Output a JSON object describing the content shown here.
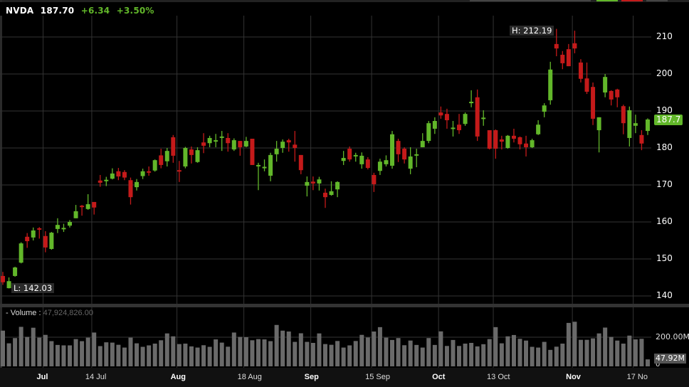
{
  "header": {
    "symbol": "NVDA",
    "price": "187.70",
    "change": "+6.34",
    "change_pct": "+3.50%"
  },
  "labels": {
    "high": "H: 212.19",
    "low": "L: 142.03",
    "current": "187.7"
  },
  "volume": {
    "label": "- Volume :",
    "value": "47,924,826.00",
    "axis_label": "200.00M",
    "zero_label": "0",
    "current": "47.92M"
  },
  "colors": {
    "up": "#62b72a",
    "down": "#c41a1a",
    "volume": "#6a6a6a",
    "grid": "#333333"
  },
  "chart_data": {
    "type": "candlestick",
    "title": "NVDA",
    "yticks": [
      140,
      150,
      160,
      170,
      180,
      190,
      200,
      210
    ],
    "ylim": [
      138,
      216
    ],
    "xticks": [
      {
        "label": "Jul",
        "i": 7,
        "bold": true
      },
      {
        "label": "14 Jul",
        "i": 15,
        "bold": false
      },
      {
        "label": "Aug",
        "i": 29,
        "bold": true
      },
      {
        "label": "18 Aug",
        "i": 40,
        "bold": false
      },
      {
        "label": "Sep",
        "i": 51,
        "bold": true
      },
      {
        "label": "15 Sep",
        "i": 61,
        "bold": false
      },
      {
        "label": "Oct",
        "i": 72,
        "bold": true
      },
      {
        "label": "13 Oct",
        "i": 81,
        "bold": false
      },
      {
        "label": "Nov",
        "i": 94,
        "bold": true
      },
      {
        "label": "17 No",
        "i": 104,
        "bold": false
      }
    ],
    "ohlc": [
      [
        145.4,
        146.5,
        143,
        143.7
      ],
      [
        142.1,
        145,
        142.03,
        144.0
      ],
      [
        145.4,
        147.9,
        145.2,
        147.7
      ],
      [
        149,
        154.5,
        148.8,
        154.2
      ],
      [
        156,
        157,
        153,
        154.8
      ],
      [
        155.8,
        158.5,
        155,
        157.7
      ],
      [
        158.3,
        158.6,
        155.5,
        157.9
      ],
      [
        156.2,
        157.5,
        151.8,
        153.1
      ],
      [
        152.7,
        157.3,
        152.5,
        157.1
      ],
      [
        158.1,
        161,
        157,
        159.2
      ],
      [
        158.2,
        159.5,
        157.3,
        158.4
      ],
      [
        159,
        160.5,
        158.5,
        160
      ],
      [
        161,
        164.6,
        161,
        162.9
      ],
      [
        164.4,
        164.6,
        161.7,
        164
      ],
      [
        163.5,
        167.5,
        163.3,
        164.8
      ],
      [
        165.4,
        165.4,
        162,
        163.9
      ],
      [
        171.2,
        172.7,
        169.5,
        170.6
      ],
      [
        171.2,
        172.2,
        169.7,
        171.4
      ],
      [
        171.7,
        174.5,
        171.5,
        173.1
      ],
      [
        173.7,
        174.6,
        171.3,
        172.3
      ],
      [
        173.5,
        174,
        171.3,
        172.0
      ],
      [
        171.3,
        172,
        164.7,
        166.7
      ],
      [
        169.4,
        171.6,
        168.5,
        170.8
      ],
      [
        172.4,
        174.4,
        171.6,
        173.7
      ],
      [
        173.7,
        175,
        172.5,
        173.5
      ],
      [
        173.9,
        176.9,
        173.6,
        176.7
      ],
      [
        178,
        179.8,
        174.5,
        175.4
      ],
      [
        176.4,
        180,
        175,
        179.2
      ],
      [
        182.9,
        183.5,
        176,
        177.9
      ],
      [
        174,
        176.5,
        170.8,
        173.7
      ],
      [
        175,
        180.3,
        174.5,
        180
      ],
      [
        179.6,
        180.4,
        175.8,
        178.1
      ],
      [
        176.2,
        180.2,
        176,
        179.4
      ],
      [
        181.5,
        184,
        178.6,
        180.6
      ],
      [
        181.3,
        183.3,
        180.2,
        182.7
      ],
      [
        181.9,
        183.8,
        180.2,
        182.1
      ],
      [
        182.9,
        184.6,
        179.2,
        183.1
      ],
      [
        182.7,
        184,
        179,
        181.3
      ],
      [
        179.6,
        182.6,
        179.2,
        182.1
      ],
      [
        181.9,
        181.9,
        177.9,
        180.2
      ],
      [
        180.4,
        183,
        180.2,
        181.9
      ],
      [
        182.5,
        182.5,
        175.4,
        175.4
      ],
      [
        175.2,
        176,
        168.6,
        175.4
      ],
      [
        174.6,
        176.9,
        173.7,
        174.9
      ],
      [
        172.5,
        178.7,
        171,
        178.1
      ],
      [
        178.3,
        181.9,
        176.3,
        179.8
      ],
      [
        180,
        182.3,
        178.7,
        181.7
      ],
      [
        182.1,
        182.5,
        179,
        181.5
      ],
      [
        180.9,
        184.6,
        176.3,
        180
      ],
      [
        178.1,
        178.1,
        172.9,
        174
      ],
      [
        169.8,
        172.3,
        166.9,
        170.8
      ],
      [
        170.9,
        172.3,
        168.6,
        170.4
      ],
      [
        170.4,
        172.2,
        168.5,
        171.5
      ],
      [
        167.9,
        169,
        163.8,
        166.7
      ],
      [
        167.3,
        171,
        167.1,
        168.3
      ],
      [
        168.8,
        171,
        166.7,
        170.8
      ],
      [
        176.5,
        179.2,
        175.4,
        177.3
      ],
      [
        179.8,
        180.4,
        176.3,
        176.9
      ],
      [
        177.9,
        178.7,
        176.3,
        178.1
      ],
      [
        175.6,
        178.8,
        174.4,
        177.9
      ],
      [
        176.9,
        177.5,
        174.2,
        174.6
      ],
      [
        172.7,
        173.3,
        168.1,
        170.2
      ],
      [
        173.8,
        177.1,
        172.7,
        176.3
      ],
      [
        175.6,
        178,
        175,
        176.7
      ],
      [
        175.2,
        184.6,
        174.4,
        183.7
      ],
      [
        181.9,
        182.5,
        176.2,
        178.3
      ],
      [
        179.8,
        180.2,
        175.8,
        176.9
      ],
      [
        174.4,
        180.2,
        172.9,
        177.7
      ],
      [
        178.1,
        179.8,
        174.8,
        178.3
      ],
      [
        180.2,
        184,
        180.2,
        181.9
      ],
      [
        181.9,
        187.3,
        181.3,
        186.7
      ],
      [
        185.2,
        188.3,
        183.8,
        187.3
      ],
      [
        189.6,
        191.2,
        187.9,
        188.8
      ],
      [
        189.2,
        190.6,
        185.2,
        187.5
      ],
      [
        185.3,
        187.3,
        183.1,
        185.5
      ],
      [
        186.3,
        189.2,
        183.8,
        184.8
      ],
      [
        186.5,
        189.6,
        186,
        189.2
      ],
      [
        192.1,
        195.6,
        191,
        192.5
      ],
      [
        193.7,
        195.8,
        181.9,
        183.1
      ],
      [
        188,
        190.2,
        186,
        188.2
      ],
      [
        184.8,
        184.8,
        179.6,
        179.8
      ],
      [
        184.8,
        185,
        177.1,
        179.8
      ],
      [
        182.3,
        183.3,
        179.6,
        181.7
      ],
      [
        180,
        183.5,
        179.8,
        183.3
      ],
      [
        183.3,
        185.2,
        181.5,
        182.5
      ],
      [
        182.9,
        183.1,
        179.6,
        181
      ],
      [
        181.2,
        183.3,
        177.7,
        180.2
      ],
      [
        180.2,
        182.5,
        180,
        182.1
      ],
      [
        183.7,
        187.5,
        183.5,
        186.3
      ],
      [
        189.8,
        192.1,
        188.3,
        191.5
      ],
      [
        192.9,
        203.3,
        191.7,
        201.2
      ],
      [
        208.1,
        212.19,
        204.8,
        206.9
      ],
      [
        205.2,
        206.2,
        201.3,
        202.9
      ],
      [
        206.7,
        208.1,
        202.1,
        202.1
      ],
      [
        208.3,
        211.7,
        205.6,
        206.9
      ],
      [
        203.1,
        204,
        197.7,
        198.7
      ],
      [
        198.8,
        203.1,
        194.6,
        195.2
      ],
      [
        196.5,
        197.7,
        186.2,
        187.9
      ],
      [
        184.8,
        188.3,
        178.8,
        188.3
      ],
      [
        195,
        200,
        193.7,
        199.2
      ],
      [
        195.4,
        195.6,
        191.5,
        193.1
      ],
      [
        195.8,
        196,
        191,
        193.7
      ],
      [
        191.3,
        191.7,
        183.7,
        186.7
      ],
      [
        182.7,
        191.2,
        180.4,
        190.2
      ],
      [
        186,
        189,
        184,
        186.7
      ],
      [
        183.5,
        184.8,
        179.4,
        181.2
      ],
      [
        184.6,
        188,
        183.5,
        187.7
      ]
    ],
    "volume_ylim": [
      0,
      330
    ],
    "volume_ticks": [
      0,
      200
    ],
    "volumes_millions": [
      245,
      158,
      194,
      271,
      202,
      265,
      197,
      216,
      173,
      147,
      144,
      144,
      187,
      173,
      197,
      232,
      139,
      165,
      163,
      148,
      129,
      197,
      158,
      134,
      144,
      156,
      179,
      226,
      206,
      153,
      156,
      137,
      129,
      145,
      134,
      185,
      163,
      135,
      232,
      202,
      200,
      179,
      187,
      185,
      173,
      284,
      245,
      239,
      168,
      227,
      168,
      161,
      226,
      153,
      148,
      174,
      129,
      144,
      174,
      216,
      198,
      239,
      269,
      197,
      181,
      194,
      145,
      177,
      147,
      129,
      194,
      147,
      240,
      140,
      181,
      140,
      156,
      161,
      137,
      152,
      187,
      269,
      158,
      206,
      215,
      189,
      177,
      134,
      129,
      168,
      113,
      135,
      156,
      298,
      306,
      182,
      182,
      192,
      226,
      266,
      202,
      177,
      156,
      211,
      185,
      189,
      47.92
    ]
  }
}
